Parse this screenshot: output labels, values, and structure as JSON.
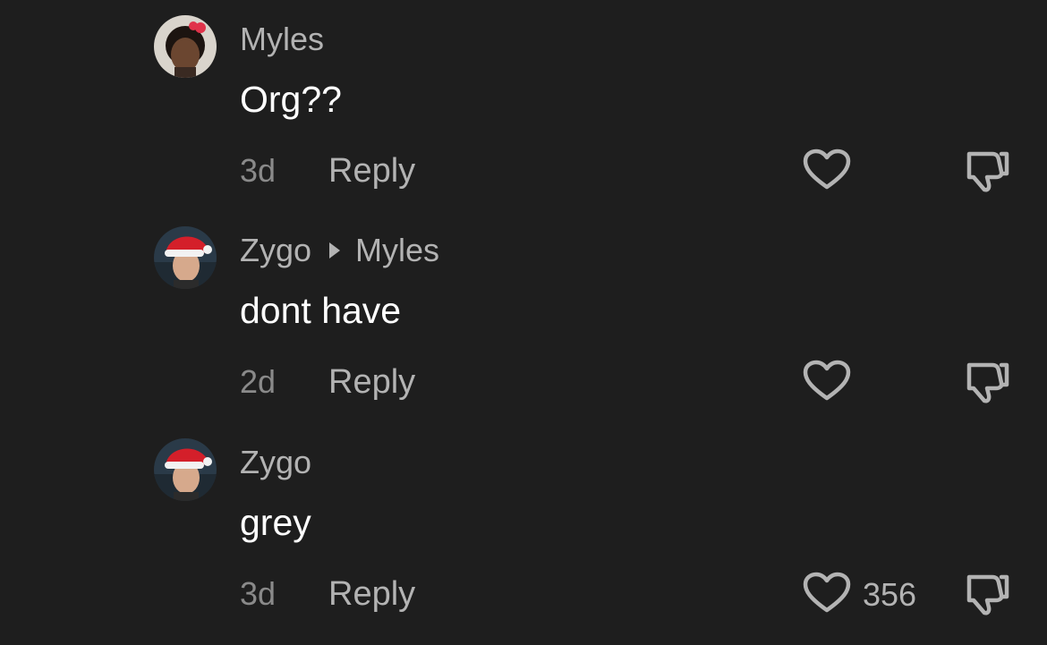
{
  "colors": {
    "background": "#1e1e1e",
    "username": "#b3b3b3",
    "comment_text": "#ffffff",
    "timestamp": "#8a8a8a",
    "icon": "#b3b3b3"
  },
  "comments": [
    {
      "username": "Myles",
      "text": "Org??",
      "time": "3d",
      "reply_label": "Reply",
      "avatar_icon": "user-avatar",
      "like_icon": "heart-outline-icon",
      "dislike_icon": "thumbs-down-icon"
    },
    {
      "username": "Zygo",
      "reply_to": "Myles",
      "text": "dont have",
      "time": "2d",
      "reply_label": "Reply",
      "avatar_icon": "user-avatar",
      "like_icon": "heart-outline-icon",
      "dislike_icon": "thumbs-down-icon"
    },
    {
      "username": "Zygo",
      "text": "grey",
      "time": "3d",
      "reply_label": "Reply",
      "like_count": "356",
      "avatar_icon": "user-avatar",
      "like_icon": "heart-outline-icon",
      "dislike_icon": "thumbs-down-icon"
    }
  ]
}
